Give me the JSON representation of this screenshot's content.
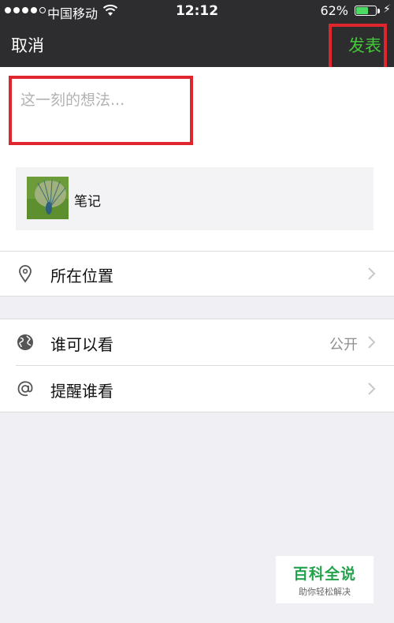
{
  "status_bar": {
    "carrier": "中国移动",
    "time": "12:12",
    "battery": "62%",
    "battery_level": 0.62,
    "signal_bars": 4,
    "signal_max": 5
  },
  "nav": {
    "cancel_label": "取消",
    "post_label": "发表",
    "post_color": "#41c936"
  },
  "compose": {
    "placeholder": "这一刻的想法..."
  },
  "share": {
    "title": "笔记"
  },
  "rows": {
    "location": {
      "label": "所在位置",
      "icon": "location-pin-icon"
    },
    "visibility": {
      "label": "谁可以看",
      "value": "公开",
      "icon": "globe-icon"
    },
    "mention": {
      "label": "提醒谁看",
      "icon": "at-sign-icon"
    }
  },
  "watermark": {
    "title": "百科全说",
    "subtitle": "助你轻松解决"
  },
  "colors": {
    "highlight": "#e0262d",
    "nav_background": "#2d2d2f",
    "page_background": "#efeff4"
  }
}
